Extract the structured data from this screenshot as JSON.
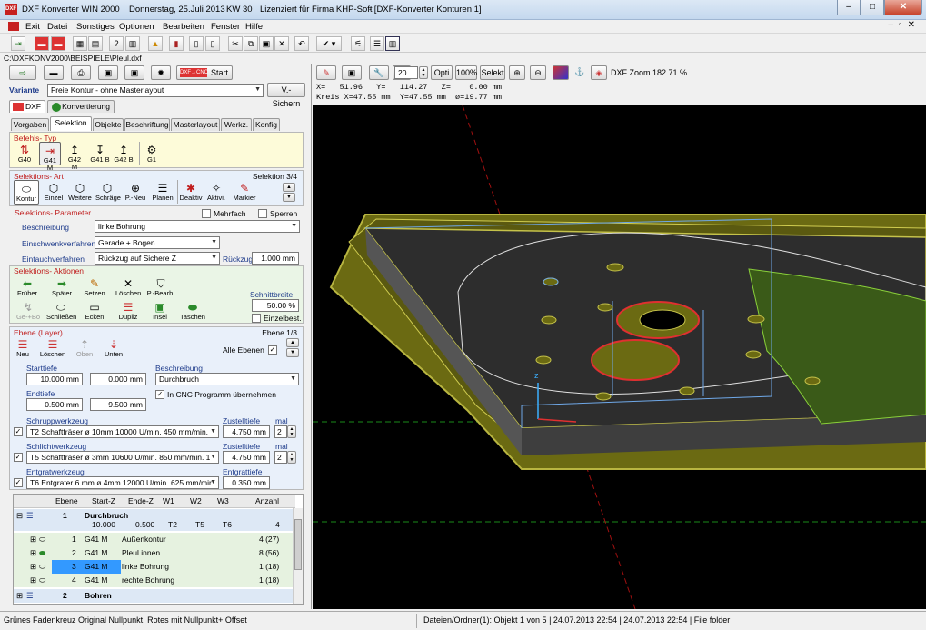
{
  "window": {
    "title": "DXF Konverter WIN 2000",
    "date": "Donnerstag, 25.Juli 2013",
    "week": "KW 30",
    "license": "Lizenziert für Firma KHP-Soft",
    "doc": "- [DXF-Konverter Konturen 1]"
  },
  "menu": [
    "Exit",
    "Datei",
    "Sonstiges",
    "Optionen",
    "Bearbeiten",
    "Fenster",
    "Hilfe"
  ],
  "path": "C:\\DXFKONV2000\\BEISPIELE\\Pleul.dxf",
  "start_label": "Start",
  "variante": {
    "label": "Variante",
    "value": "Freie Kontur - ohne Masterlayout",
    "button": "V.-Sichern"
  },
  "modetabs": [
    "DXF",
    "Konvertierung"
  ],
  "tabs": [
    "Vorgaben",
    "Selektion",
    "Objekte",
    "Beschriftung",
    "Masterlayout",
    "Werkz.",
    "Konfig"
  ],
  "befehl": {
    "title": "Befehls- Typ",
    "items": [
      "G40",
      "G41 M",
      "G42 M",
      "G41 B",
      "G42 B",
      "G1"
    ]
  },
  "selart": {
    "title": "Selektions- Art",
    "counter": "Selektion  3/4",
    "items": [
      "Kontur",
      "Einzel",
      "Weitere",
      "Schräge",
      "P.-Neu",
      "Planen",
      "Deaktiv",
      "Aktivi.",
      "Markier"
    ]
  },
  "mehrfach": "Mehrfach",
  "sperren": "Sperren",
  "params": {
    "title": "Selektions- Parameter",
    "beschreibung_label": "Beschreibung",
    "beschreibung": "linke Bohrung",
    "einschwenk_label": "Einschwenkverfahren",
    "einschwenk": "Gerade + Bogen",
    "eintauch_label": "Eintauchverfahren",
    "eintauch": "Rückzug auf Sichere Z",
    "rueckzug_label": "Rückzug",
    "rueckzug": "1.000 mm"
  },
  "aktionen": {
    "title": "Selektions- Aktionen",
    "row1": [
      "Früher",
      "Später",
      "Setzen",
      "Löschen",
      "P.-Bearb."
    ],
    "row2": [
      "Ge-+Bö",
      "Schließen",
      "Ecken",
      "Dupliz",
      "Insel",
      "Taschen"
    ],
    "schnittbreite_label": "Schnittbreite",
    "schnittbreite": "50.00 %",
    "einzelbest": "Einzelbest."
  },
  "ebene": {
    "title": "Ebene (Layer)",
    "counter": "Ebene  1/3",
    "buttons": [
      "Neu",
      "Löschen",
      "Oben",
      "Unten"
    ],
    "alle": "Alle Ebenen",
    "starttiefe_label": "Starttiefe",
    "start1": "10.000 mm",
    "start2": "0.000 mm",
    "endtiefe_label": "Endtiefe",
    "end1": "0.500 mm",
    "end2": "9.500 mm",
    "beschreibung_label": "Beschreibung",
    "beschreibung": "Durchbruch",
    "cnc": "In CNC Programm übernehmen"
  },
  "werkzeuge": {
    "schrupp_label": "Schruppwerkzeug",
    "schrupp": "T2  Schaftfräser  ø 10mm  10000 U/min.  450 mm/min.",
    "schrupp_zust": "4.750 mm",
    "schrupp_mal": "2",
    "schlicht_label": "Schlichtwerkzeug",
    "schlicht": "T5  Schaftfräser  ø 3mm  10600 U/min.  850 mm/min.  1",
    "schlicht_zust": "4.750 mm",
    "schlicht_mal": "2",
    "entgrat_label": "Entgratwerkzeug",
    "entgrat": "T6  Entgrater 6 mm  ø 4mm  12000 U/min.  625 mm/mir",
    "entgrat_tiefe": "0.350 mm",
    "zustell_label": "Zustelltiefe",
    "mal_label": "mal",
    "entgratt_label": "Entgrattiefe"
  },
  "grid": {
    "headers": [
      "Ebene",
      "Start-Z",
      "Ende-Z",
      "W1",
      "W2",
      "W3",
      "Anzahl"
    ],
    "layer1": {
      "num": "1",
      "name": "Durchbruch",
      "start": "10.000",
      "end": "0.500",
      "w1": "T2",
      "w2": "T5",
      "w3": "T6",
      "anzahl": "4"
    },
    "rows": [
      {
        "n": "1",
        "cmd": "G41 M",
        "name": "Außenkontur",
        "anz": "4 (27)"
      },
      {
        "n": "2",
        "cmd": "G41 M",
        "name": "Pleul innen",
        "anz": "8 (56)"
      },
      {
        "n": "3",
        "cmd": "G41 M",
        "name": "linke Bohrung",
        "anz": "1 (18)"
      },
      {
        "n": "4",
        "cmd": "G41 M",
        "name": "rechte Bohrung",
        "anz": "1 (18)"
      }
    ],
    "layer2": {
      "num": "2",
      "name": "Bohren"
    }
  },
  "view": {
    "zoom_value": "20",
    "buttons": [
      "Opti",
      "100%",
      "Selekt"
    ],
    "zoom_label": "DXF Zoom 182.71 %",
    "coords": "X=   51.96   Y=   114.27   Z=    0.00 mm",
    "kreis": "Kreis X=47.55 mm  Y=47.55 mm  ø=19.77 mm"
  },
  "status": {
    "left": "Grünes Fadenkreuz Original Nullpunkt, Rotes mit Nullpunkt+ Offset",
    "right": "Dateien/Ordner(1): Objekt 1 von 5 | 24.07.2013 22:54 | 24.07.2013 22:54 | File folder"
  },
  "colors": {
    "accent": "#1e3b8b",
    "selection": "#3399ff",
    "part": "#6b6a12",
    "view_bg": "#000000"
  }
}
